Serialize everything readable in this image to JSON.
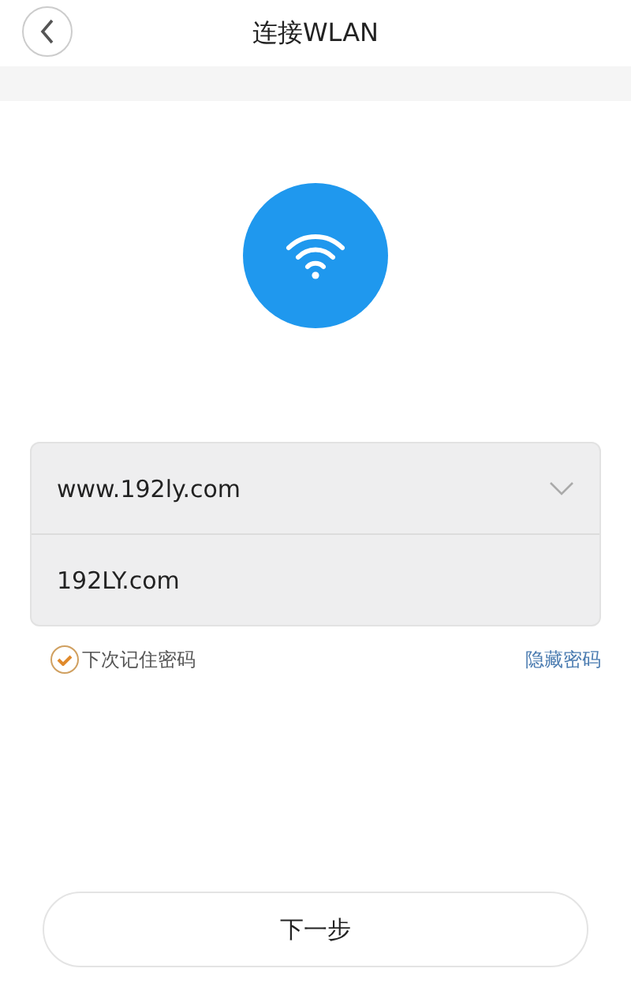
{
  "header": {
    "title": "连接WLAN"
  },
  "form": {
    "ssid": "www.192ly.com",
    "password": "192LY.com"
  },
  "remember": {
    "label": "下次记住密码",
    "checked": true
  },
  "hide_password": {
    "label": "隐藏密码"
  },
  "next_button": {
    "label": "下一步"
  }
}
